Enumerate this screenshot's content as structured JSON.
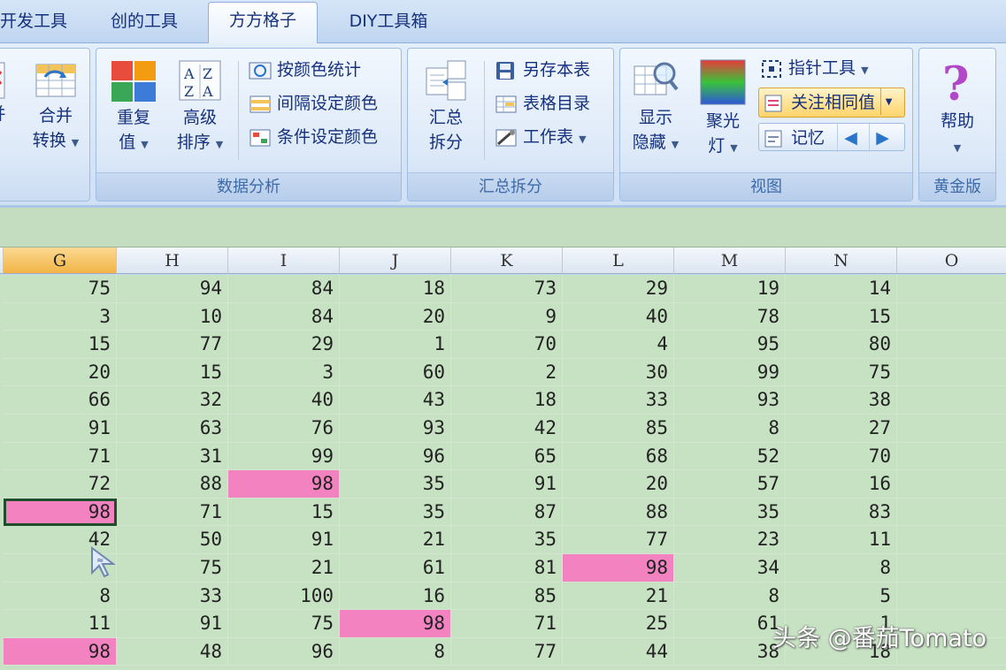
{
  "tabs": [
    {
      "label": "开发工具",
      "active": false
    },
    {
      "label": "创的工具",
      "active": false
    },
    {
      "label": "方方格子",
      "active": true
    },
    {
      "label": "DIY工具箱",
      "active": false
    }
  ],
  "ribbon": {
    "group0": {
      "merge_label": "合并",
      "convert_label": "转换"
    },
    "data_analysis": {
      "label": "数据分析",
      "dup_line1": "重复",
      "dup_line2": "值",
      "sort_line1": "高级",
      "sort_line2": "排序",
      "color_stat": "按颜色统计",
      "interval_color": "间隔设定颜色",
      "cond_color": "条件设定颜色"
    },
    "summary_split": {
      "label": "汇总拆分",
      "split_line1": "汇总",
      "split_line2": "拆分",
      "save_sheet": "另存本表",
      "table_index": "表格目录",
      "worksheet": "工作表"
    },
    "view": {
      "label": "视图",
      "show_line1": "显示",
      "show_line2": "隐藏",
      "spot_line1": "聚光",
      "spot_line2": "灯",
      "pointer_tool": "指针工具",
      "focus_same": "关注相同值",
      "memory": "记忆"
    },
    "gold": {
      "label": "黄金版",
      "help": "帮助"
    }
  },
  "columns": [
    "G",
    "H",
    "I",
    "J",
    "K",
    "L",
    "M",
    "N",
    "O"
  ],
  "selected_column": "G",
  "rows": [
    [
      "75",
      "94",
      "84",
      "18",
      "73",
      "29",
      "19",
      "14",
      ""
    ],
    [
      "3",
      "10",
      "84",
      "20",
      "9",
      "40",
      "78",
      "15",
      ""
    ],
    [
      "15",
      "77",
      "29",
      "1",
      "70",
      "4",
      "95",
      "80",
      ""
    ],
    [
      "20",
      "15",
      "3",
      "60",
      "2",
      "30",
      "99",
      "75",
      ""
    ],
    [
      "66",
      "32",
      "40",
      "43",
      "18",
      "33",
      "93",
      "38",
      ""
    ],
    [
      "91",
      "63",
      "76",
      "93",
      "42",
      "85",
      "8",
      "27",
      ""
    ],
    [
      "71",
      "31",
      "99",
      "96",
      "65",
      "68",
      "52",
      "70",
      ""
    ],
    [
      "72",
      "88",
      "98",
      "35",
      "91",
      "20",
      "57",
      "16",
      ""
    ],
    [
      "98",
      "71",
      "15",
      "35",
      "87",
      "88",
      "35",
      "83",
      ""
    ],
    [
      "42",
      "50",
      "91",
      "21",
      "35",
      "77",
      "23",
      "11",
      ""
    ],
    [
      "",
      "75",
      "21",
      "61",
      "81",
      "98",
      "34",
      "8",
      ""
    ],
    [
      "8",
      "33",
      "100",
      "16",
      "85",
      "21",
      "8",
      "5",
      ""
    ],
    [
      "11",
      "91",
      "75",
      "98",
      "71",
      "25",
      "61",
      "1",
      ""
    ],
    [
      "98",
      "48",
      "96",
      "8",
      "77",
      "44",
      "38",
      "18",
      ""
    ]
  ],
  "highlight_value": "98",
  "colors": {
    "highlight": "#f282c0",
    "sheet_bg": "#c6e2c2",
    "selected_header": "#f2b447"
  },
  "watermark": "头条 @番茄Tomato"
}
